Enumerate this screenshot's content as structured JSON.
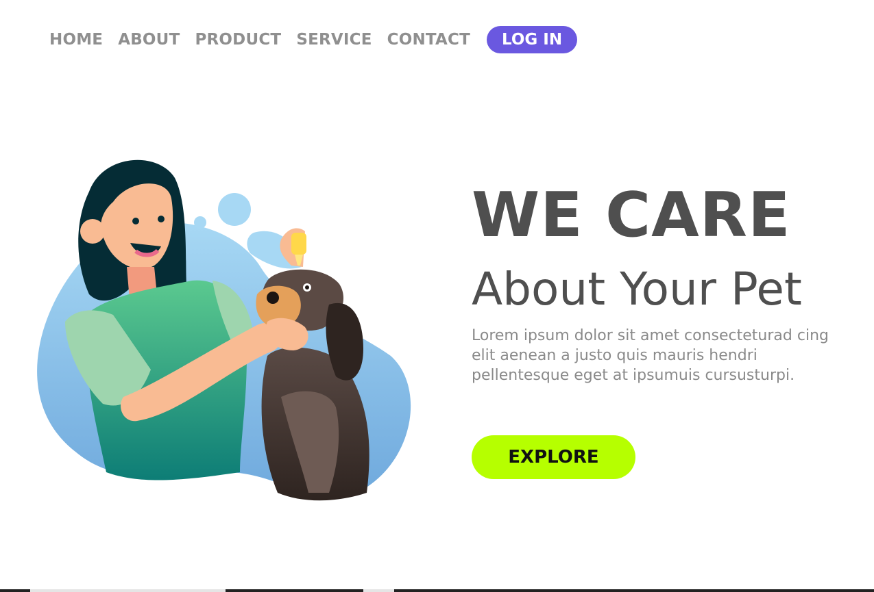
{
  "nav": {
    "items": [
      "HOME",
      "ABOUT",
      "PRODUCT",
      "SERVICE",
      "CONTACT"
    ],
    "login_label": "LOG IN"
  },
  "hero": {
    "title_line1": "WE CARE",
    "title_line2": "About Your Pet",
    "body": "Lorem ipsum dolor sit amet consecteturad cing elit aenean a justo quis mauris hendri pellentesque eget at ipsumuis cursusturpi.",
    "cta_label": "EXPLORE"
  },
  "colors": {
    "accent_purple": "#6a58e0",
    "cta_lime": "#b6ff00",
    "nav_gray": "#8f8f8f",
    "heading_gray": "#4f4f4f"
  }
}
